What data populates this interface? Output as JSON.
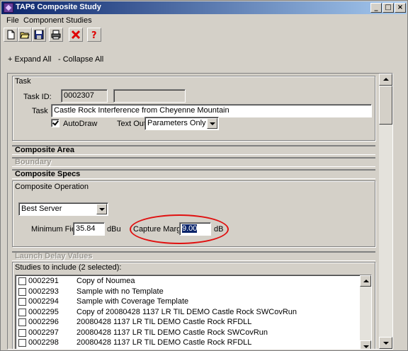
{
  "window": {
    "title": "TAP6 Composite Study"
  },
  "menu": {
    "file": "File",
    "component_studies": "Component Studies"
  },
  "toolbar": {
    "icons": [
      "new-icon",
      "open-icon",
      "save-icon",
      "print-icon",
      "delete-icon",
      "help-icon"
    ]
  },
  "tree_controls": {
    "expand_all": "+ Expand All",
    "collapse_all": "- Collapse All"
  },
  "task": {
    "group_label": "Task",
    "task_id_label": "Task ID:",
    "task_id_value": "0002307",
    "task_id_extra": "",
    "task_label": "Task",
    "task_value": "Castle Rock Interference from Cheyenne Mountain",
    "autodraw_label": "AutoDraw",
    "autodraw_checked": true,
    "text_out_label": "Text Out:",
    "text_out_value": "Parameters Only"
  },
  "sections": {
    "composite_area": "Composite Area",
    "boundary": "Boundary",
    "composite_specs": "Composite Specs",
    "launch_delay": "Launch Delay Values"
  },
  "composite_operation": {
    "group_label": "Composite Operation",
    "operation_value": "Best Server",
    "min_field_label": "Minimum Field",
    "min_field_value": "35.84",
    "min_field_unit": "dBu",
    "capture_margin_label": "Capture Margin",
    "capture_margin_value": "9.00",
    "capture_margin_unit": "dB"
  },
  "studies": {
    "label": "Studies to include (2 selected):",
    "rows": [
      {
        "id": "0002291",
        "name": "Copy of Noumea"
      },
      {
        "id": "0002293",
        "name": "Sample with no Template"
      },
      {
        "id": "0002294",
        "name": "Sample with Coverage Template"
      },
      {
        "id": "0002295",
        "name": "Copy of 20080428 1137 LR TIL DEMO Castle Rock SWCovRun"
      },
      {
        "id": "0002296",
        "name": "20080428 1137 LR TIL DEMO Castle Rock RFDLL"
      },
      {
        "id": "0002297",
        "name": "20080428 1137 LR TIL DEMO Castle Rock SWCovRun"
      },
      {
        "id": "0002298",
        "name": "20080428 1137 LR TIL DEMO Castle Rock RFDLL"
      }
    ]
  },
  "colors": {
    "title_start": "#0a246a",
    "title_end": "#a6caf0",
    "highlight_circle": "#e01010",
    "selection": "#0a246a"
  }
}
